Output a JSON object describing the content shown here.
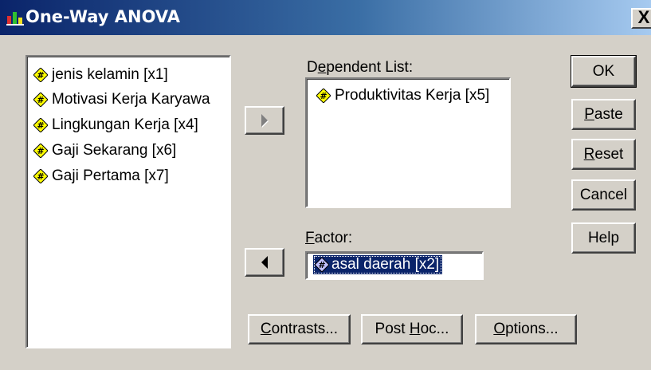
{
  "window": {
    "title": "One-Way ANOVA",
    "close_label": "X"
  },
  "variables": [
    {
      "label": "jenis kelamin [x1]"
    },
    {
      "label": "Motivasi Kerja Karyawa"
    },
    {
      "label": "Lingkungan Kerja [x4]"
    },
    {
      "label": "Gaji Sekarang [x6]"
    },
    {
      "label": "Gaji Pertama [x7]"
    }
  ],
  "dependent_list": {
    "label_pre": "D",
    "label_hot": "e",
    "label_post": "pendent List:",
    "items": [
      {
        "label": "Produktivitas Kerja [x5]"
      }
    ]
  },
  "factor": {
    "label_hot": "F",
    "label_post": "actor:",
    "value": "asal daerah [x2]"
  },
  "buttons": {
    "ok": "OK",
    "paste": {
      "hot": "P",
      "rest": "aste"
    },
    "reset": {
      "hot": "R",
      "rest": "eset"
    },
    "cancel": "Cancel",
    "help": "Help",
    "contrasts": {
      "hot": "C",
      "rest": "ontrasts..."
    },
    "posthoc": {
      "pre": "Post ",
      "hot": "H",
      "rest": "oc..."
    },
    "options": {
      "hot": "O",
      "rest": "ptions..."
    }
  },
  "icons": {
    "variable": "scale-variable-icon",
    "nominal": "nominal-variable-icon",
    "app": "spss-app-icon"
  },
  "colors": {
    "titlebar_start": "#0a246a",
    "titlebar_end": "#a6caf0",
    "dialog_bg": "#d4d0c8",
    "icon_yellow": "#ffff00",
    "selection": "#0a246a"
  }
}
